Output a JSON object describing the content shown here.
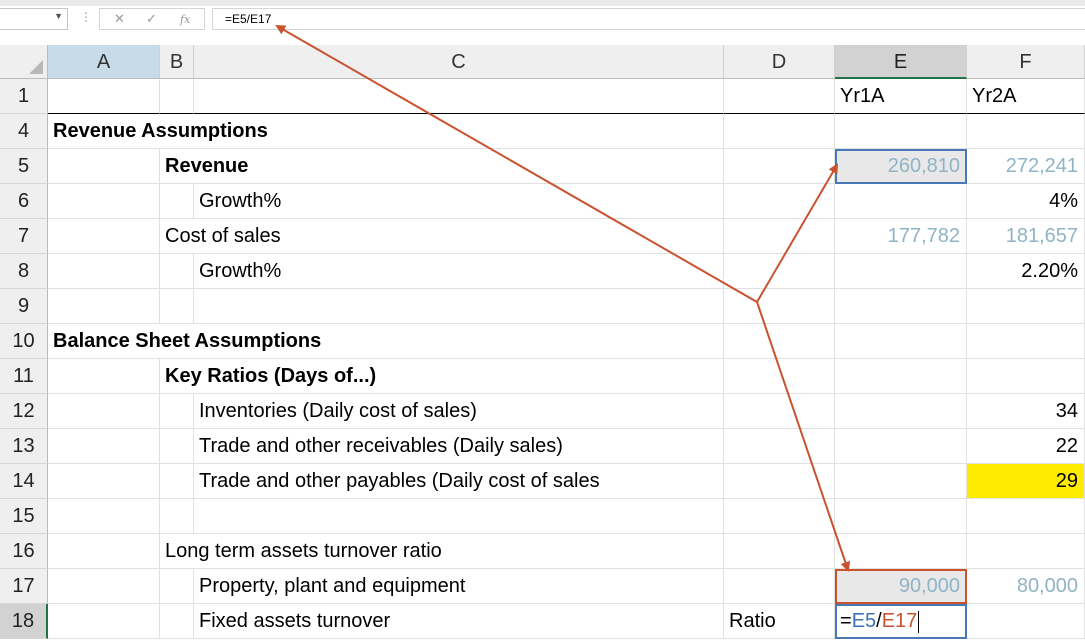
{
  "formula_bar": {
    "name_box": "",
    "cancel_icon": "✕",
    "enter_icon": "✓",
    "fx_icon": "fx",
    "formula": "=E5/E17"
  },
  "columns": [
    "A",
    "B",
    "C",
    "D",
    "E",
    "F"
  ],
  "rows": [
    {
      "num": "1",
      "c": "",
      "d": "",
      "e": "Yr1A",
      "f": "Yr2A"
    },
    {
      "num": "4",
      "a": "Revenue Assumptions"
    },
    {
      "num": "5",
      "b": "Revenue",
      "e": "260,810",
      "f": "272,241"
    },
    {
      "num": "6",
      "c": "Growth%",
      "f": "4%"
    },
    {
      "num": "7",
      "b": "Cost of sales",
      "e": "177,782",
      "f": "181,657"
    },
    {
      "num": "8",
      "c": "Growth%",
      "f": "2.20%"
    },
    {
      "num": "9"
    },
    {
      "num": "10",
      "a": "Balance Sheet Assumptions"
    },
    {
      "num": "11",
      "b": "Key Ratios (Days of...)"
    },
    {
      "num": "12",
      "c": "Inventories (Daily cost of sales)",
      "f": "34"
    },
    {
      "num": "13",
      "c": "Trade and other receivables (Daily sales)",
      "f": "22"
    },
    {
      "num": "14",
      "c": "Trade and other payables (Daily cost of sales",
      "f": "29"
    },
    {
      "num": "15"
    },
    {
      "num": "16",
      "b": "Long term assets turnover ratio"
    },
    {
      "num": "17",
      "c": "Property, plant and equipment",
      "e": "90,000",
      "f": "80,000"
    },
    {
      "num": "18",
      "c": "Fixed assets turnover",
      "d": "Ratio"
    }
  ],
  "edit_cell": {
    "eq": "=",
    "ref1": "E5",
    "slash": "/",
    "ref2": "E17"
  },
  "colors": {
    "ref_blue": "#4a78b5",
    "ref_red": "#c9522f",
    "highlight": "#ffeb00",
    "arrow": "#c9522f"
  }
}
